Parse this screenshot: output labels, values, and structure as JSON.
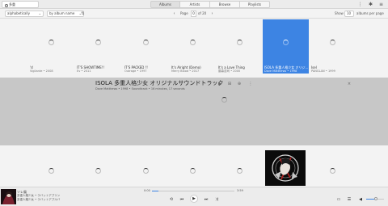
{
  "search": {
    "value": "多重"
  },
  "tabs": [
    {
      "label": "Albums",
      "active": true
    },
    {
      "label": "Artists"
    },
    {
      "label": "Browse"
    },
    {
      "label": "Playlists"
    }
  ],
  "toolbar": {
    "sort_field": "alphabetically",
    "sort_by": "by album name",
    "page_prefix": "Page",
    "page_value": "0",
    "page_suffix": "of 20",
    "show_label": "Show",
    "per_page_value": "10",
    "per_page_label": "albums per page"
  },
  "albums_row1": [
    {
      "title": "'d",
      "artist": "Vigilante",
      "year": "2008"
    },
    {
      "title": "IT'S SHOWTIME!!",
      "artist": "Ev",
      "year": "2011"
    },
    {
      "title": "IT'S PACKED !!",
      "artist": "Outrage",
      "year": "1997"
    },
    {
      "title": "It's Alright (Demo)",
      "artist": "Merry Blood",
      "year": "2017"
    },
    {
      "title": "It's a Love Thing",
      "artist": "藤森浩司",
      "year": "2000"
    },
    {
      "title": "ISOLA 多重人格少女 オリジ...",
      "artist": "Dave Matthews",
      "year": "1998",
      "selected": true
    },
    {
      "title": "Isel",
      "artist": "PANGLAN",
      "year": "1999"
    }
  ],
  "detail": {
    "title": "ISOLA 多重人格少女 オリジナルサウンドトラック",
    "subtitle": "Dave Matthews • 1998 • Soundtrack • 16 minutes, 17 seconds"
  },
  "player": {
    "title": "ソレ風",
    "artist": "多重人格少女 • ラバットアプリン",
    "album": "多重人格少女 • ラバットアプルバ",
    "elapsed": "0:00",
    "duration": "3:59",
    "progress": 0.08,
    "volume": 0.55
  },
  "colors": {
    "accent": "#3d84e3",
    "detail_bg": "#c7c7c7",
    "page_bg": "#f3f3f3"
  }
}
